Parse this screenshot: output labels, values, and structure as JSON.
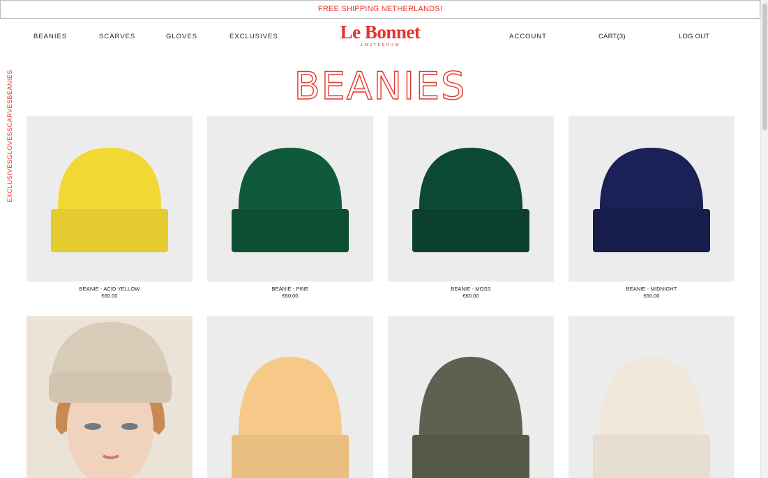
{
  "announcement": "FREE SHIPPING NETHERLANDS!",
  "nav": {
    "left": [
      "BEANIES",
      "SCARVES",
      "GLOVES",
      "EXCLUSIVES"
    ],
    "account": "ACCOUNT",
    "cart": "CART(3)",
    "logout": "LOG OUT"
  },
  "logo": {
    "main": "Le Bonnet",
    "sub": "AMSTERDAM"
  },
  "side_nav": [
    "BEANIES",
    "SCARVES",
    "GLOVES",
    "EXCLUSIVES"
  ],
  "page_title": "BEANIES",
  "products": [
    {
      "name": "BEANIE - ACID YELLOW",
      "price": "€60.00",
      "color": "#f2d833"
    },
    {
      "name": "BEANIE - PINE",
      "price": "€60.00",
      "color": "#0f5a3a"
    },
    {
      "name": "BEANIE - MOSS",
      "price": "€60.00",
      "color": "#0d4a33"
    },
    {
      "name": "BEANIE - MIDNIGHT",
      "price": "€60.00",
      "color": "#1a2156"
    },
    {
      "name": "",
      "price": "",
      "color": "#d8cbb8"
    },
    {
      "name": "",
      "price": "",
      "color": "#f7c988"
    },
    {
      "name": "",
      "price": "",
      "color": "#5d6150"
    },
    {
      "name": "",
      "price": "",
      "color": "#f1e8da"
    }
  ],
  "accent_color": "#e8332a"
}
